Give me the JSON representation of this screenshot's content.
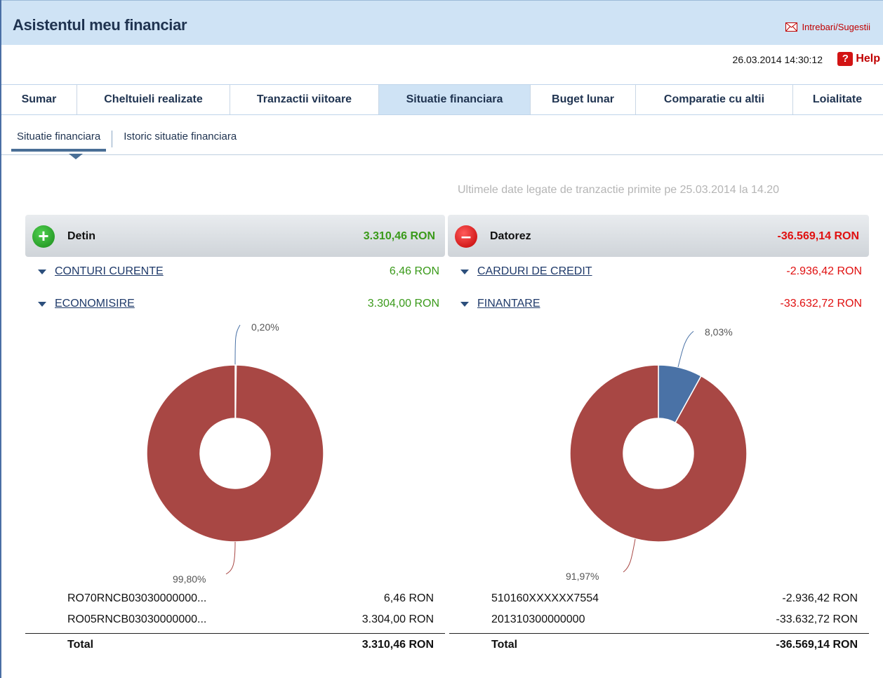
{
  "app": {
    "title": "Asistentul meu financiar",
    "feedback_label": "Intrebari/Sugestii",
    "datetime": "26.03.2014 14:30:12",
    "help_label": "Help"
  },
  "tabs": [
    {
      "label": "Sumar",
      "active": false
    },
    {
      "label": "Cheltuieli realizate",
      "active": false
    },
    {
      "label": "Tranzactii viitoare",
      "active": false
    },
    {
      "label": "Situatie financiara",
      "active": true
    },
    {
      "label": "Buget lunar",
      "active": false
    },
    {
      "label": "Comparatie cu altii",
      "active": false
    },
    {
      "label": "Loialitate",
      "active": false
    }
  ],
  "subtabs": [
    {
      "label": "Situatie financiara",
      "active": true
    },
    {
      "label": "Istoric situatie financiara",
      "active": false
    }
  ],
  "last_data_note": "Ultimele date legate de tranzactie primite pe 25.03.2014 la 14.20",
  "assets": {
    "label": "Detin",
    "total": "3.310,46 RON",
    "categories": [
      {
        "name": "CONTURI CURENTE",
        "value": "6,46 RON"
      },
      {
        "name": "ECONOMISIRE",
        "value": "3.304,00 RON"
      }
    ],
    "accounts": [
      {
        "account": "RO70RNCB03030000000...",
        "amount": "6,46 RON"
      },
      {
        "account": "RO05RNCB03030000000...",
        "amount": "3.304,00 RON"
      }
    ],
    "total_label": "Total",
    "total_amount": "3.310,46 RON"
  },
  "liabilities": {
    "label": "Datorez",
    "total": "-36.569,14 RON",
    "categories": [
      {
        "name": "CARDURI DE CREDIT",
        "value": "-2.936,42 RON"
      },
      {
        "name": "FINANTARE",
        "value": "-33.632,72 RON"
      }
    ],
    "accounts": [
      {
        "account": "510160XXXXXX7554",
        "amount": "-2.936,42 RON"
      },
      {
        "account": "201310300000000",
        "amount": "-33.632,72 RON"
      }
    ],
    "total_label": "Total",
    "total_amount": "-36.569,14 RON"
  },
  "colors": {
    "positive": "#3a9a1a",
    "negative": "#e01010",
    "slice_main": "#a84744",
    "slice_minor": "#4a72a6",
    "header_bg": "#cfe3f5"
  },
  "chart_data": [
    {
      "type": "pie",
      "variant": "donut",
      "labels": [
        "0,20%",
        "99,80%"
      ],
      "values": [
        0.2,
        99.8
      ],
      "colors": [
        "#4a72a6",
        "#a84744"
      ]
    },
    {
      "type": "pie",
      "variant": "donut",
      "labels": [
        "8,03%",
        "91,97%"
      ],
      "values": [
        8.03,
        91.97
      ],
      "colors": [
        "#4a72a6",
        "#a84744"
      ]
    }
  ]
}
